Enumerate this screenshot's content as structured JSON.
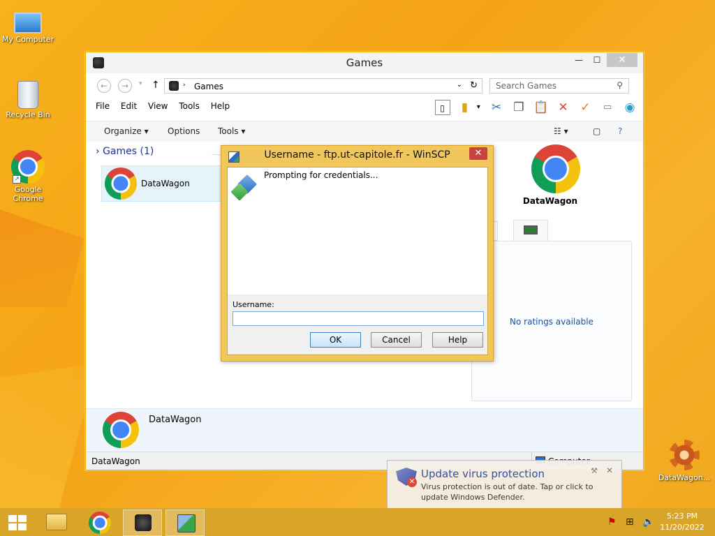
{
  "desktop": {
    "icons": [
      {
        "label": "My Computer"
      },
      {
        "label": "Recycle Bin"
      },
      {
        "label": "Google Chrome"
      },
      {
        "label": "DataWagon..."
      }
    ]
  },
  "explorer": {
    "title": "Games",
    "address_crumb": "Games",
    "search_placeholder": "Search Games",
    "menu": [
      "File",
      "Edit",
      "View",
      "Tools",
      "Help"
    ],
    "commands": {
      "organize": "Organize",
      "options": "Options",
      "tools": "Tools"
    },
    "group_label": "Games (1)",
    "item_label": "DataWagon",
    "preview_title": "DataWagon",
    "rating_text": "No ratings available",
    "details_label": "DataWagon",
    "status_left": "DataWagon",
    "status_right": "Computer"
  },
  "dialog": {
    "title": "Username - ftp.ut-capitole.fr - WinSCP",
    "prompt": "Prompting for credentials...",
    "username_label": "Username:",
    "username_value": "",
    "ok": "OK",
    "cancel": "Cancel",
    "help": "Help"
  },
  "notification": {
    "title": "Update virus protection",
    "body": "Virus protection is out of date. Tap or click to update Windows Defender."
  },
  "taskbar": {
    "time": "5:23 PM",
    "date": "11/20/2022"
  },
  "colors": {
    "wallpaper": "#f6ad1e",
    "dialog_frame": "#f1c65b",
    "taskbar": "#d9a528",
    "link_blue": "#1c4fa3"
  }
}
